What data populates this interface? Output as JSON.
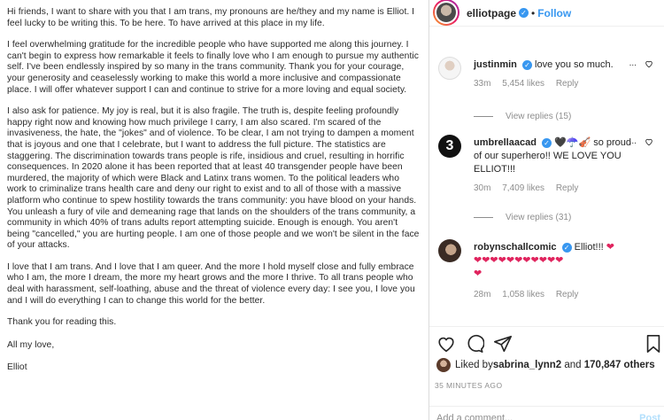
{
  "letter": {
    "paragraphs": [
      "Hi friends, I want to share with you that I am trans, my pronouns are he/they and my name is Elliot. I feel lucky to be writing this. To be here. To have arrived at this place in my life.",
      "I feel overwhelming gratitude for the incredible people who have supported me along this journey. I can't begin to express how remarkable it feels to finally love who I am enough to pursue my authentic self. I've been endlessly inspired by so many in the trans community. Thank you for your courage, your generosity and ceaselessly working to make this world a more inclusive and compassionate place. I will offer whatever support I can and continue to strive for a more loving and equal society.",
      "I also ask for patience. My joy is real, but it is also fragile. The truth is, despite feeling profoundly happy right now and knowing how much privilege I carry, I am also scared. I'm scared of the invasiveness, the hate, the \"jokes\" and of violence. To be clear, I am not trying to dampen a moment that is joyous and one that I celebrate, but I want to address the full picture. The statistics are staggering. The discrimination towards trans people is rife, insidious and cruel, resulting in horrific consequences. In 2020 alone it has been reported that at least 40 transgender people have been murdered, the majority of which were Black and Latinx trans women. To the political leaders who work to criminalize trans health care and deny our right to exist and to all of those with a massive platform who continue to spew hostility towards the trans community: you have blood on your hands. You unleash a fury of vile and demeaning rage that lands on the shoulders of the trans community, a community in which 40% of trans adults report attempting suicide. Enough is enough. You aren't being \"cancelled,\" you are hurting people. I am one of those people and we won't be silent in the face of your attacks.",
      "I love that I am trans. And I love that I am queer. And the more I hold myself close and fully embrace who I am, the more I dream, the more my heart grows and the more I thrive. To all trans people who deal with harassment, self-loathing, abuse and the threat of violence every day: I see you, I love you and I will do everything I can to change this world for the better.",
      "Thank you for reading this.",
      "All my love,",
      "Elliot"
    ]
  },
  "header": {
    "username": "elliotpage",
    "verified_glyph": "✓",
    "separator": "•",
    "follow_label": "Follow"
  },
  "comments": [
    {
      "username": "justinmin",
      "text": "love you so much.",
      "time": "33m",
      "likes": "5,454 likes",
      "reply_label": "Reply",
      "view_replies": "View replies (15)",
      "avatar_icon": "person-photo"
    },
    {
      "username": "umbrellaacad",
      "text": "so proud of our superhero!! WE LOVE YOU ELLIOT!!!",
      "emoji": "🖤☂️🎻",
      "time": "30m",
      "likes": "7,409 likes",
      "reply_label": "Reply",
      "view_replies": "View replies (31)",
      "avatar_glyph": "3",
      "avatar_icon": "umbrella-academy-logo"
    },
    {
      "username": "robynschallcomic",
      "text": "Elliot!!!",
      "hearts_line1": "❤",
      "hearts_line2": "❤❤❤❤❤❤❤❤❤❤❤",
      "hearts_line3": "❤",
      "time": "28m",
      "likes": "1,058 likes",
      "reply_label": "Reply",
      "avatar_icon": "person-photo"
    }
  ],
  "comment_more_glyph": "...",
  "likes_line": {
    "prefix": "Liked by ",
    "user": "sabrina_lynn2",
    "and": " and ",
    "count": "170,847 others"
  },
  "timestamp": "35 MINUTES AGO",
  "add_comment": {
    "placeholder": "Add a comment...",
    "post_label": "Post"
  },
  "colors": {
    "link_blue": "#3897f0",
    "verified_blue": "#3897f0",
    "muted_gray": "#8e8e8e",
    "heart_red": "#e0245e"
  }
}
